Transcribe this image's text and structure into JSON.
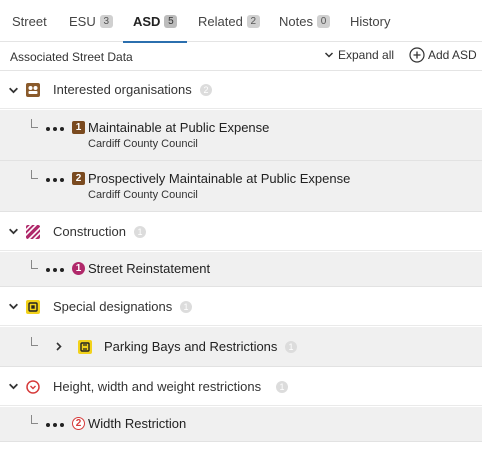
{
  "tabs": [
    {
      "label": "Street"
    },
    {
      "label": "ESU",
      "count": "3"
    },
    {
      "label": "ASD",
      "count": "5"
    },
    {
      "label": "Related",
      "count": "2"
    },
    {
      "label": "Notes",
      "count": "0"
    },
    {
      "label": "History"
    }
  ],
  "active_tab": "ASD",
  "toolbar": {
    "title": "Associated Street Data",
    "expand_label": "Expand all",
    "add_label": "Add ASD"
  },
  "groups": [
    {
      "label": "Interested organisations",
      "icon": "organisation-icon",
      "color": "#8a5a2b",
      "count": "2",
      "items": [
        {
          "marker": "1",
          "label": "Maintainable at Public Expense",
          "sub": "Cardiff County Council",
          "color": "#7a4a1f"
        },
        {
          "marker": "2",
          "label": "Prospectively Maintainable at Public Expense",
          "sub": "Cardiff County Council",
          "color": "#7a4a1f"
        }
      ]
    },
    {
      "label": "Construction",
      "icon": "construction-icon",
      "color": "#b0286a",
      "count": "1",
      "items": [
        {
          "marker": "1",
          "label": "Street Reinstatement",
          "color": "#b0286a"
        }
      ]
    },
    {
      "label": "Special designations",
      "icon": "special-designation-icon",
      "color": "#f2d21b",
      "count": "1",
      "items": [
        {
          "label": "Parking Bays and Restrictions",
          "count": "1",
          "color": "#f2d21b"
        }
      ]
    },
    {
      "label": "Height, width and weight restrictions",
      "icon": "restriction-icon",
      "color": "#d63b3b",
      "count": "1",
      "items": [
        {
          "marker": "2",
          "label": "Width Restriction",
          "color": "#d63b3b"
        }
      ]
    }
  ]
}
